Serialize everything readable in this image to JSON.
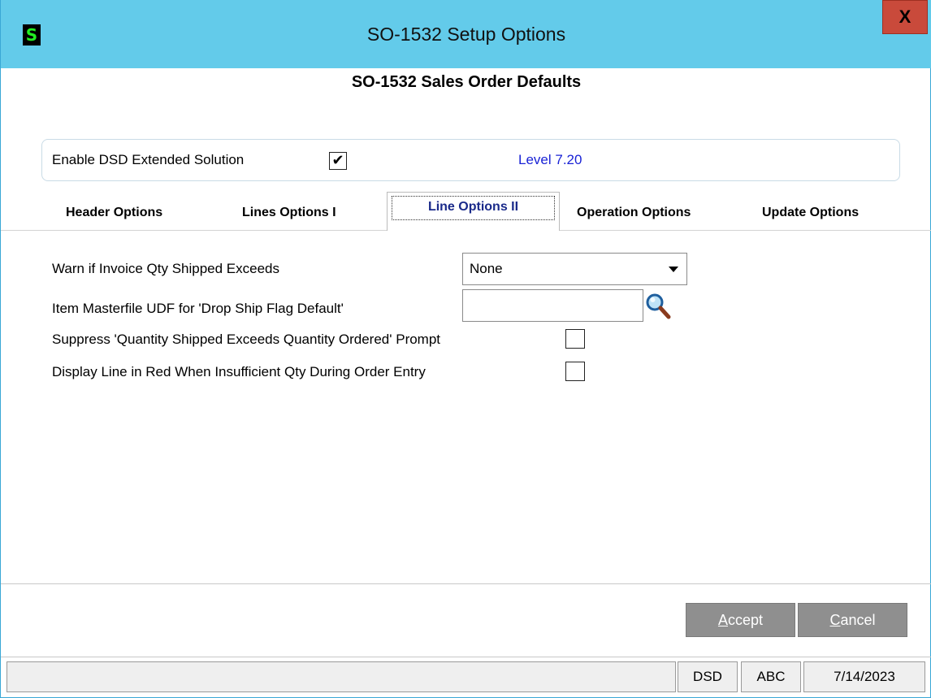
{
  "window": {
    "title": "SO-1532 Setup Options",
    "app_icon_letter": "S",
    "close_label": "X"
  },
  "heading": "SO-1532 Sales Order Defaults",
  "enable": {
    "label": "Enable DSD Extended Solution",
    "checked": true,
    "check_glyph": "✔",
    "level": "Level 7.20"
  },
  "tabs": [
    {
      "label": "Header Options",
      "active": false
    },
    {
      "label": "Lines Options I",
      "active": false
    },
    {
      "label": "Line Options II",
      "active": true
    },
    {
      "label": "Operation Options",
      "active": false
    },
    {
      "label": "Update Options",
      "active": false
    }
  ],
  "fields": {
    "warn_label": "Warn if Invoice Qty Shipped Exceeds",
    "warn_value": "None",
    "udf_label": "Item Masterfile UDF for 'Drop Ship Flag Default'",
    "udf_value": "",
    "suppress_label": "Suppress 'Quantity Shipped Exceeds Quantity Ordered' Prompt",
    "suppress_checked": false,
    "red_label": "Display Line in Red When Insufficient Qty During Order Entry",
    "red_checked": false
  },
  "buttons": {
    "accept_hotkey": "A",
    "accept_rest": "ccept",
    "cancel_hotkey": "C",
    "cancel_rest": "ancel"
  },
  "status": {
    "cell1": "",
    "cell2": "DSD",
    "cell3": "ABC",
    "date": "7/14/2023"
  },
  "colors": {
    "titlebar": "#63cbea",
    "close": "#c94a3b",
    "level_text": "#1a23d6",
    "button_disabled": "#8f8f8f"
  },
  "icons": {
    "lookup": "magnifier-icon"
  }
}
